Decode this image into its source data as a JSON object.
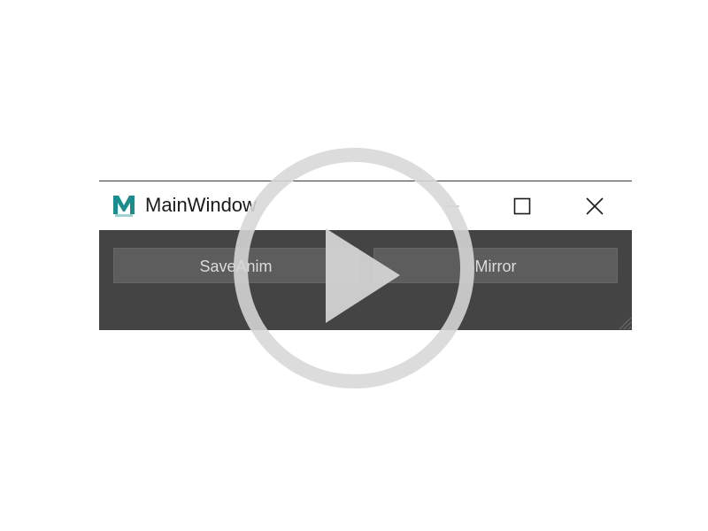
{
  "window": {
    "title": "MainWindow",
    "app_icon": "maya-m-icon",
    "controls": {
      "minimize": "minimize-icon",
      "maximize": "maximize-icon",
      "close": "close-icon"
    }
  },
  "buttons": {
    "save_anim_label": "SaveAnim",
    "mirror_label": "Mirror"
  },
  "overlay": {
    "icon": "play-icon"
  },
  "colors": {
    "titlebar": "#ffffff",
    "body": "#444444",
    "button": "#5d5d5d",
    "button_text": "#dcdcdc",
    "icon_teal": "#1a8d8f"
  }
}
